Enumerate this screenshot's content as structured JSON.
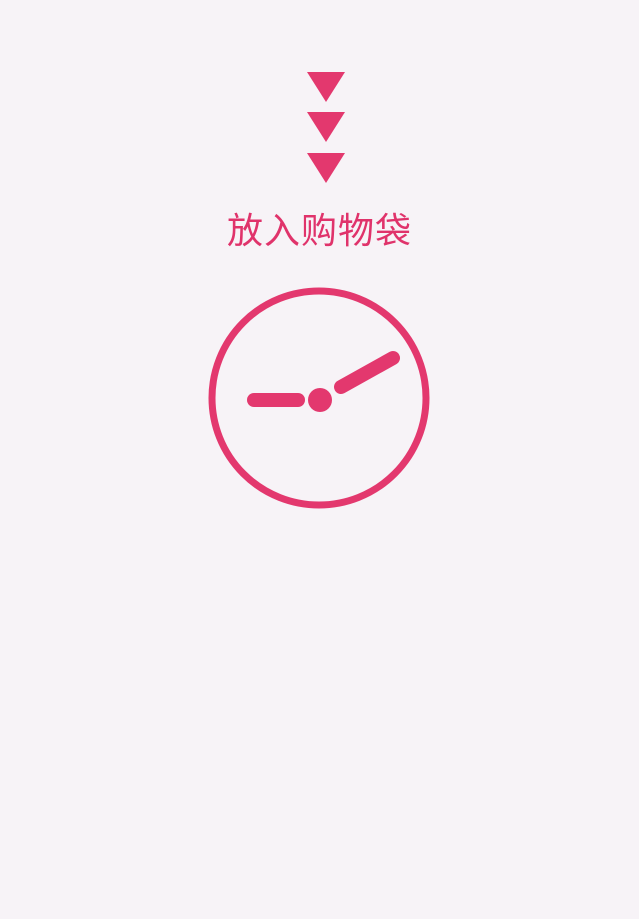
{
  "accent_color": "#e3386e",
  "background_color": "#f7f3f7",
  "icons": {
    "arrows": "triple-chevron-down-icon",
    "clock": "clock-icon"
  },
  "add_to_bag": {
    "label": "放入购物袋"
  }
}
